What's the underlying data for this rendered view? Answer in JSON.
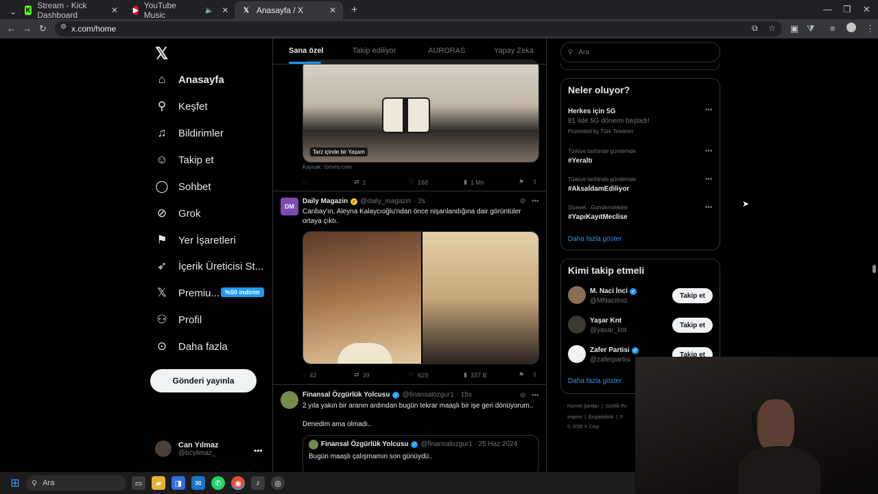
{
  "browser": {
    "tabs": [
      {
        "title": "Stream - Kick Dashboard",
        "icon": "kick-icon"
      },
      {
        "title": "YouTube Music",
        "icon": "youtube-music-icon"
      },
      {
        "title": "Anasayfa / X",
        "icon": "x-icon"
      }
    ],
    "url": "x.com/home"
  },
  "nav": {
    "items": [
      {
        "label": "Anasayfa",
        "icon": "home-icon"
      },
      {
        "label": "Keşfet",
        "icon": "search-icon"
      },
      {
        "label": "Bildirimler",
        "icon": "bell-icon"
      },
      {
        "label": "Takip et",
        "icon": "follow-icon"
      },
      {
        "label": "Sohbet",
        "icon": "chat-icon"
      },
      {
        "label": "Grok",
        "icon": "grok-icon"
      },
      {
        "label": "Yer İşaretleri",
        "icon": "bookmark-icon"
      },
      {
        "label": "İçerik Üreticisi St...",
        "icon": "rocket-icon"
      },
      {
        "label": "Premiu...",
        "icon": "x-icon"
      },
      {
        "label": "Profil",
        "icon": "profile-icon"
      },
      {
        "label": "Daha fazla",
        "icon": "more-icon"
      }
    ],
    "premium_badge": "%50 indirim",
    "post_button": "Gönderi yayınla",
    "user": {
      "name": "Can Yılmaz",
      "handle": "@bcyilmaz_"
    }
  },
  "feed": {
    "tabs": [
      "Sana özel",
      "Takip ediliyor",
      "AURORAS",
      "Yapay Zeka"
    ],
    "post1": {
      "image_caption": "Tarz içinde bir Yaşam",
      "source": "Kaynak: tommy.com",
      "retweets": "1",
      "likes": "168",
      "views": "1 Mn"
    },
    "post2": {
      "avatar_text": "DM",
      "name": "Daily Magazin",
      "handle": "@daily_magazin",
      "time": "· 2s",
      "text": "Canbay'ın, Aleyna Kalaycıoğlu'ndan önce nişanlandığına dair görüntüler ortaya çıktı.",
      "replies": "42",
      "retweets": "39",
      "likes": "629",
      "views": "337 B"
    },
    "post3": {
      "name": "Finansal Özgürlük Yolcusu",
      "handle": "@finansalozgur1",
      "time": "· 15s",
      "text1": "2 yıla yakın bir aranın ardından bugün tekrar maaşlı bir işe geri dönüyorum..",
      "text2": "Denedim ama olmadı..",
      "quote_name": "Finansal Özgürlük Yolcusu",
      "quote_handle": "@finansalozgur1 · 25 Haz 2024",
      "quote_text": "Bugün maaşlı çalışmamın son günüydü.."
    }
  },
  "right": {
    "search_placeholder": "Ara",
    "trends_title": "Neler oluyor?",
    "trends": [
      {
        "name": "Herkes için 5G",
        "sub": "81 ilde 5G dönemi başladı!",
        "promo": "Promoted by Türk Telekom"
      },
      {
        "meta": "Türkiye tarihinde gündemde",
        "name": "#Yeraltı"
      },
      {
        "meta": "Türkiye tarihinde gündemde",
        "name": "#AksaİdamEdiliyor"
      },
      {
        "meta": "Siyaset · Gündemdekiler",
        "name": "#YapıKayıtMeclise"
      }
    ],
    "show_more": "Daha fazla göster",
    "wtf_title": "Kimi takip etmeli",
    "wtf": [
      {
        "name": "M. Naci İnci",
        "handle": "@MNaciInci",
        "verified": true
      },
      {
        "name": "Yaşar Knt",
        "handle": "@yasar_knt",
        "verified": false
      },
      {
        "name": "Zafer Partisi",
        "handle": "@zaferpartisi",
        "verified": true
      }
    ],
    "follow_label": "Takip et",
    "footer": [
      "Hizmet Şartları",
      "Gizlilik Po",
      "Imprint",
      "Erişilebilirlik",
      "F",
      "© 2026 X Corp."
    ]
  },
  "taskbar": {
    "search": "Ara"
  }
}
